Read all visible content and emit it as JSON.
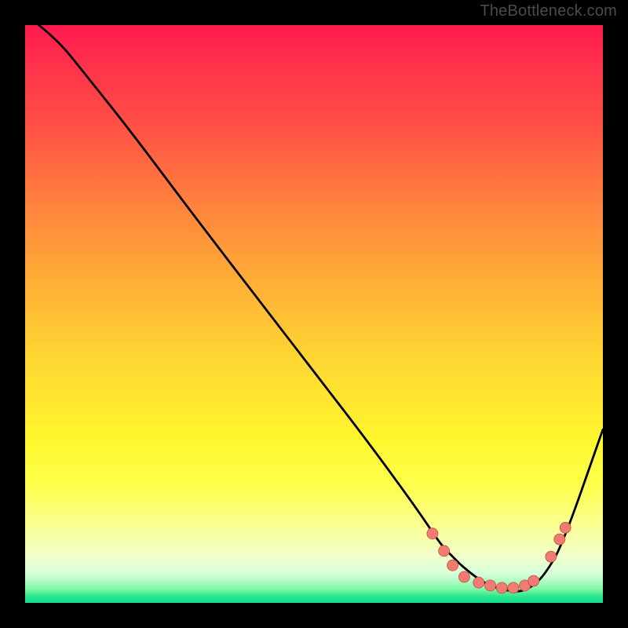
{
  "attribution": "TheBottleneck.com",
  "chart_data": {
    "type": "line",
    "title": "",
    "xlabel": "",
    "ylabel": "",
    "xlim": [
      0,
      100
    ],
    "ylim": [
      0,
      100
    ],
    "series": [
      {
        "name": "curve",
        "x": [
          0,
          6,
          10,
          18,
          30,
          40,
          50,
          60,
          68,
          72,
          74,
          76,
          80,
          84,
          86,
          88,
          90,
          93,
          100
        ],
        "y": [
          102,
          97,
          92,
          82,
          66,
          53,
          40,
          27,
          16,
          10,
          8,
          6,
          3,
          2,
          2,
          3,
          5,
          10,
          30
        ]
      }
    ],
    "markers": [
      {
        "x": 70.5,
        "y": 12
      },
      {
        "x": 72.5,
        "y": 9
      },
      {
        "x": 74.0,
        "y": 6.5
      },
      {
        "x": 76.0,
        "y": 4.5
      },
      {
        "x": 78.5,
        "y": 3.5
      },
      {
        "x": 80.5,
        "y": 3
      },
      {
        "x": 82.5,
        "y": 2.6
      },
      {
        "x": 84.5,
        "y": 2.6
      },
      {
        "x": 86.5,
        "y": 3
      },
      {
        "x": 88.0,
        "y": 3.8
      },
      {
        "x": 91.0,
        "y": 8
      },
      {
        "x": 92.5,
        "y": 11
      },
      {
        "x": 93.5,
        "y": 13
      }
    ],
    "gradient_note": "Background encodes a vertical red→yellow→green heatmap; curve shows bottleneck valley."
  }
}
